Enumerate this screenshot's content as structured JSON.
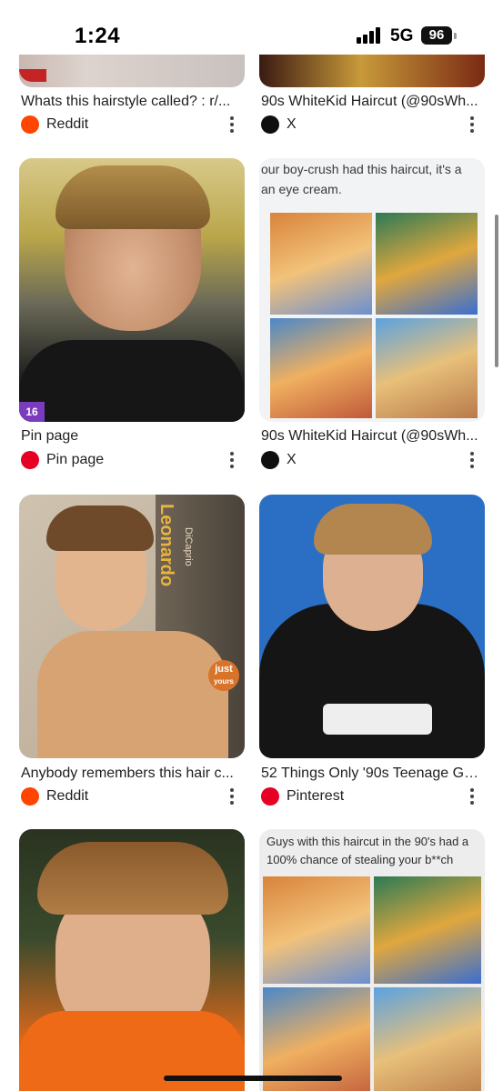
{
  "status": {
    "time": "1:24",
    "network": "5G",
    "battery": "96"
  },
  "results": [
    {
      "title": "Whats this hairstyle called? : r/...",
      "source": "Reddit",
      "source_icon": "reddit-icon"
    },
    {
      "title": "90s WhiteKid Haircut (@90sWh...",
      "source": "X",
      "source_icon": "x-icon"
    },
    {
      "title": "Pin page",
      "source": "Pin page",
      "source_icon": "pinterest-icon"
    },
    {
      "title": "90s WhiteKid Haircut (@90sWh...",
      "source": "X",
      "source_icon": "x-icon",
      "image_caption": [
        "our boy-crush had this haircut, it's a",
        "an eye cream."
      ]
    },
    {
      "title": "Anybody remembers this hair c...",
      "source": "Reddit",
      "source_icon": "reddit-icon",
      "image_caption": [
        "Leonardo",
        "DiCaprio",
        "just",
        "yours"
      ]
    },
    {
      "title": "52 Things Only '90s Teenage Gu...",
      "source": "Pinterest",
      "source_icon": "pinterest-icon"
    },
    {
      "title": "",
      "source": "",
      "source_icon": ""
    },
    {
      "title": "",
      "source": "",
      "source_icon": "",
      "image_caption": [
        "Guys with this haircut in the 90's had a",
        "100% chance of stealing your b**ch"
      ]
    }
  ],
  "colors": {
    "reddit": "#ff4500",
    "pinterest": "#e60023",
    "x": "#0f0f0f"
  }
}
